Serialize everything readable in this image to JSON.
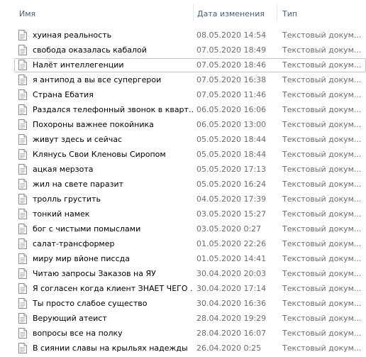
{
  "columns": {
    "name": "Имя",
    "date": "Дата изменения",
    "type": "Тип"
  },
  "files": [
    {
      "name": "хуиная реальность",
      "date": "08.05.2020 14:54",
      "type": "Текстовый докум..."
    },
    {
      "name": "свобода оказалась кабалой",
      "date": "07.05.2020 18:49",
      "type": "Текстовый докум..."
    },
    {
      "name": "Налёт интеллегенции",
      "date": "07.05.2020 18:46",
      "type": "Текстовый докум...",
      "selected": true
    },
    {
      "name": "я антипод а вы все супергерои",
      "date": "07.05.2020 16:38",
      "type": "Текстовый докум..."
    },
    {
      "name": "Страна Ебатия",
      "date": "07.05.2020 11:46",
      "type": "Текстовый докум..."
    },
    {
      "name": "Раздался телефонный звонок в кварт...",
      "date": "06.05.2020 16:06",
      "type": "Текстовый докум..."
    },
    {
      "name": "Похороны важнее покойника",
      "date": "06.05.2020 13:00",
      "type": "Текстовый докум..."
    },
    {
      "name": "живут здесь и сейчас",
      "date": "05.05.2020 18:44",
      "type": "Текстовый докум..."
    },
    {
      "name": "Клянусь Свои Кленовы Сиропом",
      "date": "05.05.2020 18:44",
      "type": "Текстовый докум..."
    },
    {
      "name": "ацкая мерзота",
      "date": "05.05.2020 17:13",
      "type": "Текстовый докум..."
    },
    {
      "name": "жил на свете паразит",
      "date": "05.05.2020 16:24",
      "type": "Текстовый докум..."
    },
    {
      "name": "тролль грустить",
      "date": "04.05.2020 17:39",
      "type": "Текстовый докум..."
    },
    {
      "name": "тонкий намек",
      "date": "03.05.2020 15:27",
      "type": "Текстовый докум..."
    },
    {
      "name": "бог с чистыми помыслами",
      "date": "03.05.2020 0:27",
      "type": "Текстовый докум..."
    },
    {
      "name": "салат-трансформер",
      "date": "01.05.2020 22:26",
      "type": "Текстовый докум..."
    },
    {
      "name": "миру мир вйоне писсда",
      "date": "01.05.2020 14:41",
      "type": "Текстовый докум..."
    },
    {
      "name": "Читаю запросы Заказов на ЯУ",
      "date": "30.04.2020 20:03",
      "type": "Текстовый докум..."
    },
    {
      "name": "Я согласен когда клиент ЗНАЕТ ЧЕГО ...",
      "date": "30.04.2020 17:14",
      "type": "Текстовый докум..."
    },
    {
      "name": "Ты просто слабое существо",
      "date": "30.04.2020 16:36",
      "type": "Текстовый докум..."
    },
    {
      "name": "Верующий атеист",
      "date": "28.04.2020 19:29",
      "type": "Текстовый докум..."
    },
    {
      "name": "вопросы все на полку",
      "date": "28.04.2020 16:07",
      "type": "Текстовый докум..."
    },
    {
      "name": "В сиянии славы на крыльях надежды",
      "date": "26.04.2020 0:25",
      "type": "Текстовый докум..."
    }
  ],
  "icon": "text-document-icon",
  "colors": {
    "header_text": "#4c607a",
    "secondary_text": "#6d6d6d",
    "selection_border": "#bcc7d6"
  }
}
